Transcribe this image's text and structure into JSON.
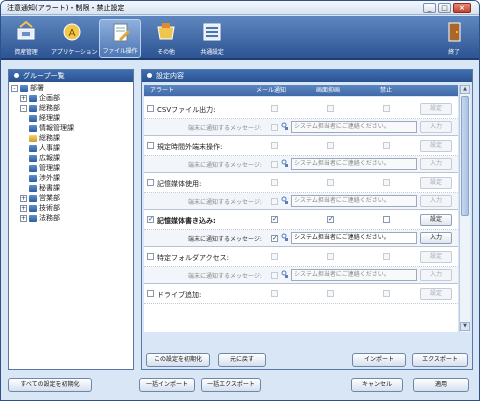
{
  "window": {
    "title": "注意通知(アラート)・制限・禁止設定",
    "min": "_",
    "max": "□",
    "close": "×"
  },
  "toolbar": {
    "items": [
      {
        "label": "資産管理",
        "icon": "computer-icon"
      },
      {
        "label": "アプリケーション",
        "icon": "application-icon"
      },
      {
        "label": "ファイル操作",
        "icon": "file-operation-icon",
        "active": true
      },
      {
        "label": "その他",
        "icon": "other-icon"
      },
      {
        "label": "共通設定",
        "icon": "common-settings-icon"
      }
    ],
    "exit_label": "終了"
  },
  "group_panel": {
    "title": "グループ一覧",
    "tree": [
      {
        "label": "部署",
        "level": 0,
        "exp": "-",
        "icon": "grp"
      },
      {
        "label": "企画部",
        "level": 1,
        "exp": "+",
        "icon": "grp"
      },
      {
        "label": "総務部",
        "level": 1,
        "exp": "-",
        "icon": "grp"
      },
      {
        "label": "経理課",
        "level": 2,
        "exp": "",
        "icon": "grp"
      },
      {
        "label": "情報管理課",
        "level": 2,
        "exp": "",
        "icon": "grp"
      },
      {
        "label": "総務課",
        "level": 2,
        "exp": "",
        "icon": "org"
      },
      {
        "label": "人事課",
        "level": 2,
        "exp": "",
        "icon": "grp"
      },
      {
        "label": "広報課",
        "level": 2,
        "exp": "",
        "icon": "grp"
      },
      {
        "label": "管理課",
        "level": 2,
        "exp": "",
        "icon": "grp"
      },
      {
        "label": "渉外課",
        "level": 2,
        "exp": "",
        "icon": "grp"
      },
      {
        "label": "秘書課",
        "level": 2,
        "exp": "",
        "icon": "grp"
      },
      {
        "label": "営業部",
        "level": 1,
        "exp": "+",
        "icon": "grp"
      },
      {
        "label": "技術部",
        "level": 1,
        "exp": "+",
        "icon": "grp"
      },
      {
        "label": "法務部",
        "level": 1,
        "exp": "+",
        "icon": "grp"
      }
    ]
  },
  "settings_panel": {
    "title": "設定内容",
    "columns": {
      "alert": "アラート",
      "mail": "メール通知",
      "screen": "画面抑画",
      "ban": "禁止"
    },
    "setting_btn": "設定",
    "input_btn": "入力",
    "notify_label": "端末に通知するメッセージ:",
    "message": "システム担当者にご連絡ください。",
    "rows": [
      {
        "label": "CSVファイル出力:",
        "enabled": false,
        "mail": false,
        "screen": false,
        "ban": false
      },
      {
        "label": "規定時間外端末操作:",
        "enabled": false,
        "mail": false,
        "screen": false,
        "ban": false
      },
      {
        "label": "記憶媒体使用:",
        "enabled": false,
        "mail": false,
        "screen": false,
        "ban": false
      },
      {
        "label": "記憶媒体書き込み:",
        "enabled": true,
        "mail": true,
        "screen": true,
        "ban": false
      },
      {
        "label": "特定フォルダアクセス:",
        "enabled": false,
        "mail": false,
        "screen": false,
        "ban": false
      },
      {
        "label": "ドライブ追加:",
        "enabled": false,
        "mail": false,
        "screen": false,
        "ban": false
      }
    ],
    "check_mark": "✓",
    "init_btn": "この設定を初期化",
    "undo_btn": "元に戻す",
    "import_btn": "インポート",
    "export_btn": "エクスポート"
  },
  "footer": {
    "reset_all": "すべての設定を初期化",
    "bulk_import": "一括インポート",
    "bulk_export": "一括エクスポート",
    "cancel": "キャンセル",
    "apply": "適用"
  }
}
